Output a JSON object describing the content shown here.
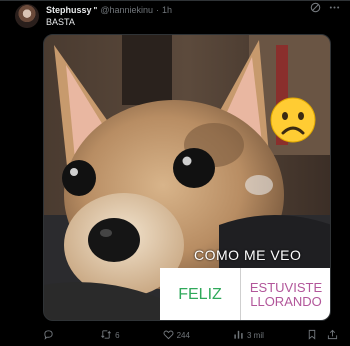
{
  "author": {
    "display_name": "Stephussy",
    "badge": "\"",
    "handle": "@hanniekinu",
    "separator": "·",
    "time": "1h"
  },
  "tweet": {
    "text": "BASTA"
  },
  "media": {
    "caption": "COMO ME VEO",
    "poll_left": "FELIZ",
    "poll_right_line1": "ESTUVISTE",
    "poll_right_line2": "LLORANDO",
    "emoji": "sad-face-emoji"
  },
  "actions": {
    "replies": "",
    "retweets": "6",
    "likes": "244",
    "views": "3 mil"
  },
  "colors": {
    "background": "#000000",
    "text": "#e7e9ea",
    "muted": "#71767b",
    "poll_left": "#2fa95a",
    "poll_right": "#b2569a"
  }
}
